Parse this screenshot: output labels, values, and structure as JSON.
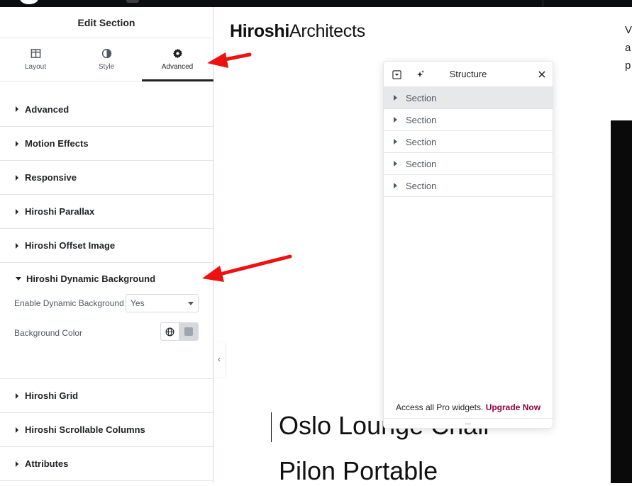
{
  "panel": {
    "title": "Edit Section",
    "tabs": [
      {
        "label": "Layout",
        "icon": "layout-icon"
      },
      {
        "label": "Style",
        "icon": "contrast-icon"
      },
      {
        "label": "Advanced",
        "icon": "gear-icon"
      }
    ],
    "sections": [
      "Advanced",
      "Motion Effects",
      "Responsive",
      "Hiroshi Parallax",
      "Hiroshi Offset Image",
      "Hiroshi Dynamic Background",
      "Hiroshi Grid",
      "Hiroshi Scrollable Columns",
      "Attributes"
    ],
    "dynamic_background": {
      "enable_label": "Enable Dynamic Background",
      "enable_value": "Yes",
      "color_label": "Background Color"
    }
  },
  "canvas": {
    "logo_bold": "Hiroshi",
    "logo_regular": "Architects",
    "right_text": [
      "V",
      "a",
      "p"
    ],
    "product_1": "Oslo Lounge Chair",
    "product_2": "Pilon Portable"
  },
  "structure": {
    "title": "Structure",
    "rows": [
      "Section",
      "Section",
      "Section",
      "Section",
      "Section"
    ],
    "footer_text": "Access all Pro widgets.",
    "footer_link": "Upgrade Now",
    "handle": "..."
  },
  "colors": {
    "annotation_arrow": "#ee1111",
    "upgrade_link": "#93003f"
  }
}
